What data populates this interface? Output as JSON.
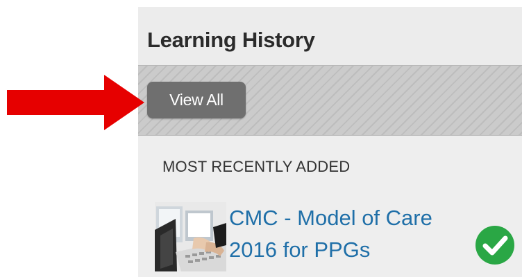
{
  "panel": {
    "title": "Learning History",
    "view_all_label": "View All",
    "section_label": "MOST RECENTLY ADDED"
  },
  "course": {
    "title_line1": "CMC - Model of Care",
    "title_line2": "2016 for PPGs",
    "status": "complete"
  },
  "icons": {
    "annotation_arrow": "red-right-arrow",
    "status_icon": "green-check-circle"
  },
  "colors": {
    "arrow": "#e60000",
    "link": "#1f6fa8",
    "button": "#6f6f6f",
    "check": "#2aa745"
  }
}
